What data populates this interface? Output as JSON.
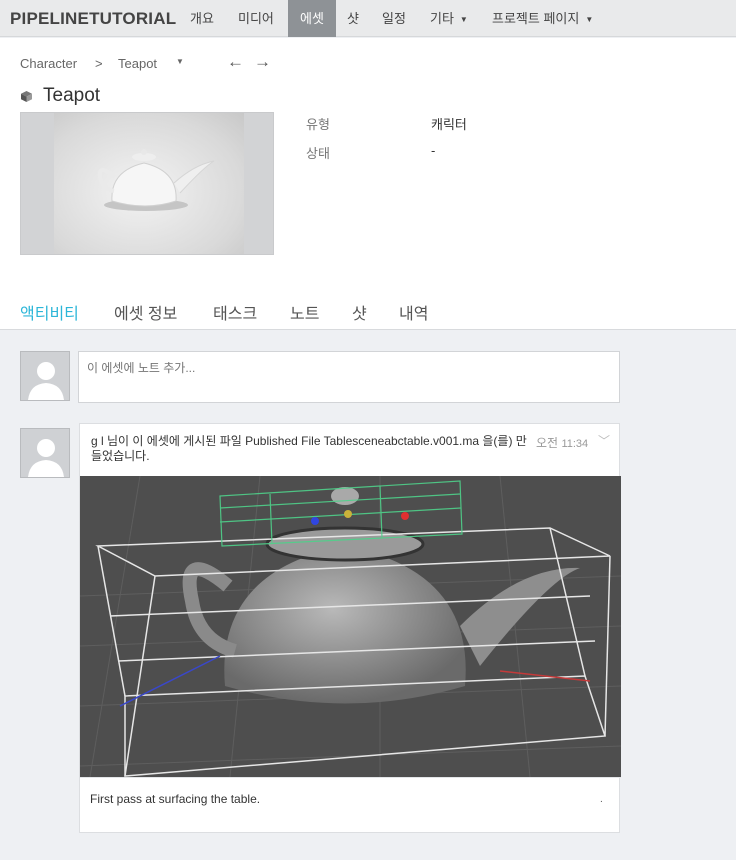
{
  "nav": {
    "brand": "PIPELINETUTORIAL",
    "items": [
      {
        "label": "개요"
      },
      {
        "label": "미디어"
      },
      {
        "label": "에셋"
      },
      {
        "label": "샷"
      },
      {
        "label": "일정"
      },
      {
        "label": "기타"
      },
      {
        "label": "프로젝트 페이지"
      }
    ]
  },
  "breadcrumb": {
    "parent": "Character",
    "separator": ">",
    "current": "Teapot",
    "prev_glyph": "←",
    "next_glyph": "→"
  },
  "asset": {
    "title": "Teapot",
    "fields": [
      {
        "label": "유형",
        "value": "캐릭터"
      },
      {
        "label": "상태",
        "value": "-"
      }
    ]
  },
  "tabs": [
    {
      "label": "액티비티"
    },
    {
      "label": "에셋 정보"
    },
    {
      "label": "태스크"
    },
    {
      "label": "노트"
    },
    {
      "label": "샷"
    },
    {
      "label": "내역"
    }
  ],
  "note_input": {
    "placeholder": "이 에셋에 노트 추가..."
  },
  "post": {
    "text": "g l 님이 이 에셋에 게시된 파일 Published File Tablesceneabctable.v001.ma 을(를) 만들었습니다.",
    "time_prefix": "오전",
    "time": "11:34",
    "comment": "First pass at surfacing the table.",
    "comment_marker": "."
  },
  "colors": {
    "accent": "#2cb6d8",
    "nav_active": "#8e9296"
  }
}
